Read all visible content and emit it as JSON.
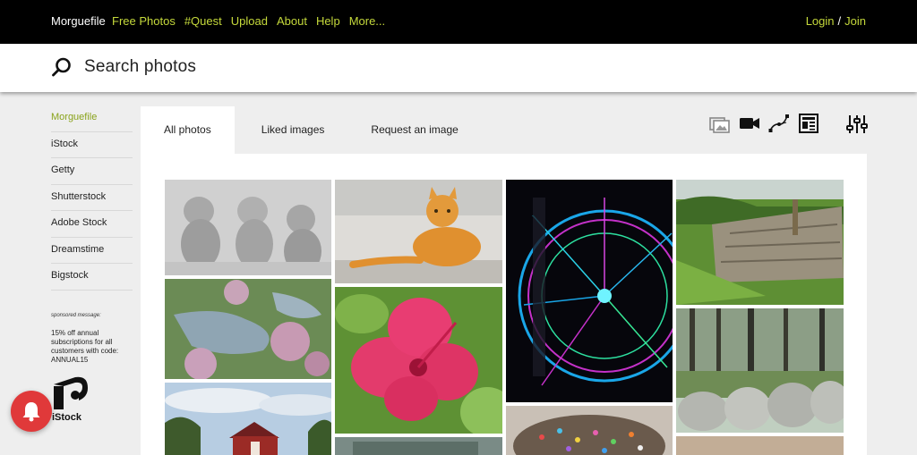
{
  "nav": {
    "brand": "Morguefile",
    "links": [
      "Free Photos",
      "#Quest",
      "Upload",
      "About",
      "Help",
      "More..."
    ],
    "login": "Login",
    "separator": "/",
    "join": "Join"
  },
  "search": {
    "placeholder": "Search photos"
  },
  "sidebar": {
    "items": [
      "Morguefile",
      "iStock",
      "Getty",
      "Shutterstock",
      "Adobe Stock",
      "Dreamstime",
      "Bigstock"
    ],
    "sponsor_label": "sponsored message:",
    "sponsor_message": "15% off annual subscriptions for all customers with code: ANNUAL15",
    "sponsor_brand": "iStock"
  },
  "tabs": [
    "All photos",
    "Liked images",
    "Request an image"
  ],
  "tools": [
    "image-filter-icon",
    "video-icon",
    "vector-icon",
    "editorial-icon",
    "filter-sliders-icon"
  ],
  "photos": [
    "monkey-statues-photo",
    "orange-cat-photo",
    "ferris-wheel-photo",
    "stone-wall-photo",
    "pond-flowers-photo",
    "hibiscus-photo",
    "forest-rocks-photo",
    "red-barn-photo",
    "sprinkles-photo",
    "partial-photo-bottom",
    "partial-photo-bottom-right"
  ],
  "colors": {
    "accent": "#c5d93b",
    "active_sidebar": "#8aa31c",
    "notify": "#e0393a"
  }
}
